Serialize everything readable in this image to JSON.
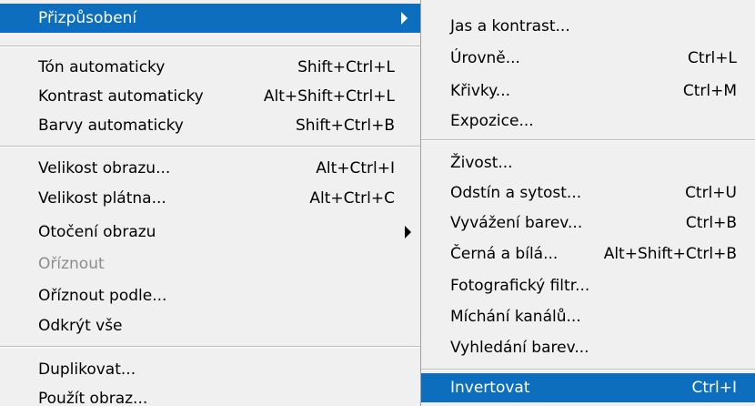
{
  "main_menu": {
    "items": [
      {
        "label": "Přizpůsobení",
        "shortcut": ""
      },
      {
        "label": "Tón automaticky",
        "shortcut": "Shift+Ctrl+L"
      },
      {
        "label": "Kontrast automaticky",
        "shortcut": "Alt+Shift+Ctrl+L"
      },
      {
        "label": "Barvy automaticky",
        "shortcut": "Shift+Ctrl+B"
      },
      {
        "label": "Velikost obrazu...",
        "shortcut": "Alt+Ctrl+I"
      },
      {
        "label": "Velikost plátna...",
        "shortcut": "Alt+Ctrl+C"
      },
      {
        "label": "Otočení obrazu",
        "shortcut": ""
      },
      {
        "label": "Oříznout",
        "shortcut": ""
      },
      {
        "label": "Oříznout podle...",
        "shortcut": ""
      },
      {
        "label": "Odkrýt vše",
        "shortcut": ""
      },
      {
        "label": "Duplikovat...",
        "shortcut": ""
      },
      {
        "label": "Použít obraz...",
        "shortcut": ""
      }
    ]
  },
  "sub_menu": {
    "items": [
      {
        "label": "Jas a kontrast...",
        "shortcut": ""
      },
      {
        "label": "Úrovně...",
        "shortcut": "Ctrl+L"
      },
      {
        "label": "Křivky...",
        "shortcut": "Ctrl+M"
      },
      {
        "label": "Expozice...",
        "shortcut": ""
      },
      {
        "label": "Živost...",
        "shortcut": ""
      },
      {
        "label": "Odstín a sytost...",
        "shortcut": "Ctrl+U"
      },
      {
        "label": "Vyvážení barev...",
        "shortcut": "Ctrl+B"
      },
      {
        "label": "Černá a bílá...",
        "shortcut": "Alt+Shift+Ctrl+B"
      },
      {
        "label": "Fotografický filtr...",
        "shortcut": ""
      },
      {
        "label": "Míchání kanálů...",
        "shortcut": ""
      },
      {
        "label": "Vyhledání barev...",
        "shortcut": ""
      },
      {
        "label": "Invertovat",
        "shortcut": "Ctrl+I"
      }
    ]
  },
  "colors": {
    "highlight": "#0d6ebd",
    "menu_background": "#f0f0f0",
    "disabled_text": "#8d8d8d"
  }
}
